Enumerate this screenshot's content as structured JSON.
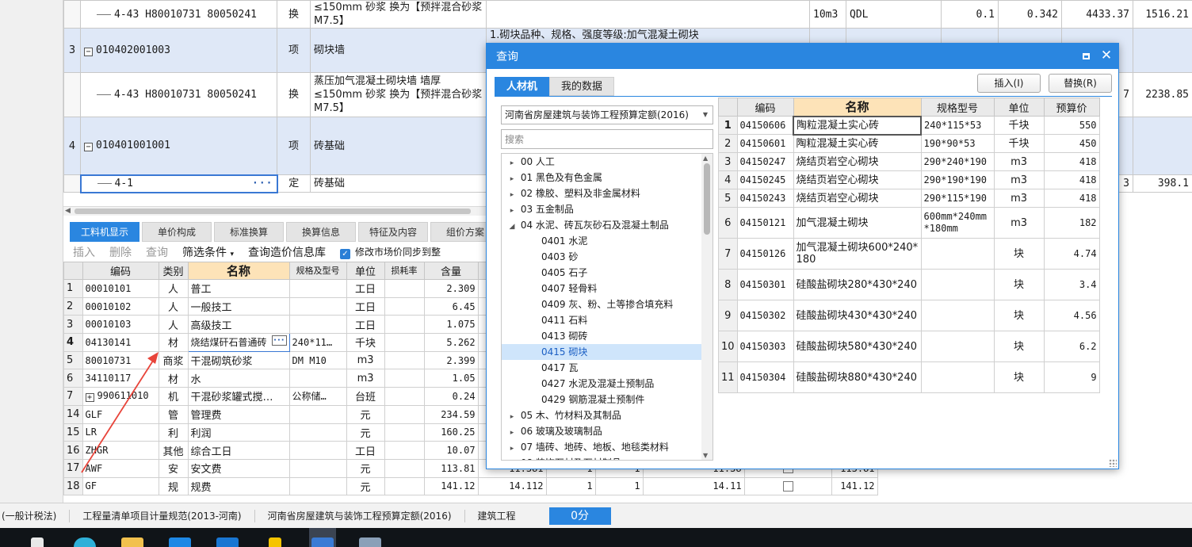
{
  "top_grid": {
    "rows": [
      {
        "kind": "sub",
        "no": "",
        "code": "4-43 H80010731 80050241",
        "type": "换",
        "name": "≤150mm 砂浆  换为【预拌混合砂浆 M7.5】",
        "feature": "",
        "unit": "10m3",
        "expr": "QDL",
        "qty1": "0.1",
        "qty2": "0.342",
        "price": "4433.37",
        "total": "1516.21"
      },
      {
        "kind": "item",
        "no": "3",
        "code": "010402001003",
        "type": "项",
        "name": "砌块墙",
        "feature": "1.砌块品种、规格、强度等级:加气混凝土砌块",
        "unit": "",
        "expr": "",
        "qty1": "",
        "qty2": "",
        "price": "",
        "total": ""
      },
      {
        "kind": "sub",
        "no": "",
        "code": "4-43 H80010731 80050241",
        "type": "换",
        "name": "蒸压加气混凝土砌块墙 墙厚≤150mm 砂浆  换为【预拌混合砂浆 M7.5】",
        "feature": "",
        "unit": "",
        "expr": "",
        "qty1": "",
        "qty2": "",
        "price": "7",
        "total": "2238.85"
      },
      {
        "kind": "item",
        "no": "4",
        "code": "010401001001",
        "type": "项",
        "name": "砖基础",
        "feature": "",
        "unit": "",
        "expr": "",
        "qty1": "",
        "qty2": "",
        "price": "",
        "total": ""
      },
      {
        "kind": "sub",
        "no": "",
        "code": "4-1",
        "type": "定",
        "name": "砖基础",
        "feature": "",
        "unit": "",
        "expr": "",
        "qty1": "",
        "qty2": "",
        "price": "3",
        "total": "398.1"
      }
    ]
  },
  "bottom_tabs": [
    "工料机显示",
    "单价构成",
    "标准换算",
    "换算信息",
    "特征及内容",
    "组价方案"
  ],
  "toolbar": {
    "insert": "插入",
    "delete": "删除",
    "query": "查询",
    "filter": "筛选条件",
    "query_info": "查询造价信息库",
    "sync_label": "修改市场价同步到整"
  },
  "bottom_grid": {
    "headers": [
      "",
      "编码",
      "类别",
      "名称",
      "规格及型号",
      "单位",
      "损耗率",
      "含量",
      "",
      "",
      "",
      "",
      "",
      ""
    ],
    "rows": [
      {
        "no": "1",
        "code": "00010101",
        "cat": "人",
        "name": "普工",
        "spec": "",
        "unit": "工日",
        "loss": "",
        "qty": "2.309",
        "c1": "",
        "c2": "",
        "c3": "",
        "c4": "",
        "c5": "",
        "c6": ""
      },
      {
        "no": "2",
        "code": "00010102",
        "cat": "人",
        "name": "一般技工",
        "spec": "",
        "unit": "工日",
        "loss": "",
        "qty": "6.45",
        "c1": "",
        "c2": "",
        "c3": "",
        "c4": "",
        "c5": "",
        "c6": ""
      },
      {
        "no": "3",
        "code": "00010103",
        "cat": "人",
        "name": "高级技工",
        "spec": "",
        "unit": "工日",
        "loss": "",
        "qty": "1.075",
        "c1": "",
        "c2": "",
        "c3": "",
        "c4": "",
        "c5": "",
        "c6": ""
      },
      {
        "no": "4",
        "code": "04130141",
        "cat": "材",
        "name": "烧结煤矸石普通砖",
        "spec": "240*11…",
        "unit": "千块",
        "loss": "",
        "qty": "5.262",
        "c1": "",
        "c2": "",
        "c3": "",
        "c4": "",
        "c5": "",
        "c6": ""
      },
      {
        "no": "5",
        "code": "80010731",
        "cat": "商浆",
        "name": "干混砌筑砂浆",
        "spec": "DM M10",
        "unit": "m3",
        "loss": "",
        "qty": "2.399",
        "c1": "",
        "c2": "",
        "c3": "",
        "c4": "",
        "c5": "",
        "c6": ""
      },
      {
        "no": "6",
        "code": "34110117",
        "cat": "材",
        "name": "水",
        "spec": "",
        "unit": "m3",
        "loss": "",
        "qty": "1.05",
        "c1": "",
        "c2": "",
        "c3": "",
        "c4": "",
        "c5": "",
        "c6": ""
      },
      {
        "no": "7",
        "code": "990611010",
        "cat": "机",
        "name": "干混砂浆罐式搅…",
        "spec": "公称储…",
        "unit": "台班",
        "loss": "",
        "qty": "0.24",
        "c1": "",
        "c2": "",
        "c3": "",
        "c4": "",
        "c5": "",
        "c6": ""
      },
      {
        "no": "14",
        "code": "GLF",
        "cat": "管",
        "name": "管理费",
        "spec": "",
        "unit": "元",
        "loss": "",
        "qty": "234.59",
        "c1": "",
        "c2": "",
        "c3": "",
        "c4": "",
        "c5": "",
        "c6": ""
      },
      {
        "no": "15",
        "code": "LR",
        "cat": "利",
        "name": "利润",
        "spec": "",
        "unit": "元",
        "loss": "",
        "qty": "160.25",
        "c1": "",
        "c2": "",
        "c3": "",
        "c4": "",
        "c5": "",
        "c6": ""
      },
      {
        "no": "16",
        "code": "ZHGR",
        "cat": "其他",
        "name": "综合工日",
        "spec": "",
        "unit": "工日",
        "loss": "",
        "qty": "10.07",
        "c1": "",
        "c2": "",
        "c3": "",
        "c4": "",
        "c5": "",
        "c6": ""
      },
      {
        "no": "17",
        "code": "AWF",
        "cat": "安",
        "name": "安文费",
        "spec": "",
        "unit": "元",
        "loss": "",
        "qty": "113.81",
        "c1": "11.381",
        "c2": "1",
        "c3": "1",
        "c4": "11.38",
        "c5": "",
        "c6": "113.81"
      },
      {
        "no": "18",
        "code": "GF",
        "cat": "规",
        "name": "规费",
        "spec": "",
        "unit": "元",
        "loss": "",
        "qty": "141.12",
        "c1": "14.112",
        "c2": "1",
        "c3": "1",
        "c4": "14.11",
        "c5": "",
        "c6": "141.12"
      }
    ]
  },
  "status_bar": {
    "tax": "(一般计税法)",
    "rule": "工程量清单项目计量规范(2013-河南)",
    "quota": "河南省房屋建筑与装饰工程预算定额(2016)",
    "project": "建筑工程",
    "score": "0分"
  },
  "dialog": {
    "title": "查询",
    "tabs": [
      "人材机",
      "我的数据"
    ],
    "insert_button": "插入(I)",
    "replace_button": "替换(R)",
    "library": "河南省房屋建筑与装饰工程预算定额(2016)",
    "search_placeholder": "搜索",
    "tree": [
      {
        "label": "00 人工",
        "level": 0,
        "expand": "right"
      },
      {
        "label": "01 黑色及有色金属",
        "level": 0,
        "expand": "right"
      },
      {
        "label": "02 橡胶、塑料及非金属材料",
        "level": 0,
        "expand": "right"
      },
      {
        "label": "03 五金制品",
        "level": 0,
        "expand": "right"
      },
      {
        "label": "04 水泥、砖瓦灰砂石及混凝土制品",
        "level": 0,
        "expand": "down"
      },
      {
        "label": "0401 水泥",
        "level": 1,
        "expand": ""
      },
      {
        "label": "0403 砂",
        "level": 1,
        "expand": ""
      },
      {
        "label": "0405 石子",
        "level": 1,
        "expand": ""
      },
      {
        "label": "0407 轻骨料",
        "level": 1,
        "expand": ""
      },
      {
        "label": "0409 灰、粉、土等掺合填充料",
        "level": 1,
        "expand": ""
      },
      {
        "label": "0411 石料",
        "level": 1,
        "expand": ""
      },
      {
        "label": "0413 砌砖",
        "level": 1,
        "expand": ""
      },
      {
        "label": "0415 砌块",
        "level": 1,
        "expand": "",
        "selected": true
      },
      {
        "label": "0417 瓦",
        "level": 1,
        "expand": ""
      },
      {
        "label": "0427 水泥及混凝土预制品",
        "level": 1,
        "expand": ""
      },
      {
        "label": "0429 钢筋混凝土预制件",
        "level": 1,
        "expand": ""
      },
      {
        "label": "05 木、竹材料及其制品",
        "level": 0,
        "expand": "right"
      },
      {
        "label": "06 玻璃及玻璃制品",
        "level": 0,
        "expand": "right"
      },
      {
        "label": "07 墙砖、地砖、地板、地毯类材料",
        "level": 0,
        "expand": "right"
      },
      {
        "label": "08 装饰石材及石材制品",
        "level": 0,
        "expand": "right"
      }
    ],
    "result_headers": [
      "",
      "编码",
      "名称",
      "规格型号",
      "单位",
      "预算价"
    ],
    "results": [
      {
        "no": "1",
        "code": "04150606",
        "name": "陶粒混凝土实心砖",
        "spec": "240*115*53",
        "unit": "千块",
        "price": "550"
      },
      {
        "no": "2",
        "code": "04150601",
        "name": "陶粒混凝土实心砖",
        "spec": "190*90*53",
        "unit": "千块",
        "price": "450"
      },
      {
        "no": "3",
        "code": "04150247",
        "name": "烧结页岩空心砌块",
        "spec": "290*240*190",
        "unit": "m3",
        "price": "418"
      },
      {
        "no": "4",
        "code": "04150245",
        "name": "烧结页岩空心砌块",
        "spec": "290*190*190",
        "unit": "m3",
        "price": "418"
      },
      {
        "no": "5",
        "code": "04150243",
        "name": "烧结页岩空心砌块",
        "spec": "290*115*190",
        "unit": "m3",
        "price": "418"
      },
      {
        "no": "6",
        "code": "04150121",
        "name": "加气混凝土砌块",
        "spec": "600mm*240mm*180mm",
        "unit": "m3",
        "price": "182"
      },
      {
        "no": "7",
        "code": "04150126",
        "name": "加气混凝土砌块600*240*180",
        "spec": "",
        "unit": "块",
        "price": "4.74"
      },
      {
        "no": "8",
        "code": "04150301",
        "name": "硅酸盐砌块280*430*240",
        "spec": "",
        "unit": "块",
        "price": "3.4"
      },
      {
        "no": "9",
        "code": "04150302",
        "name": "硅酸盐砌块430*430*240",
        "spec": "",
        "unit": "块",
        "price": "4.56"
      },
      {
        "no": "10",
        "code": "04150303",
        "name": "硅酸盐砌块580*430*240",
        "spec": "",
        "unit": "块",
        "price": "6.2"
      },
      {
        "no": "11",
        "code": "04150304",
        "name": "硅酸盐砌块880*430*240",
        "spec": "",
        "unit": "块",
        "price": "9"
      }
    ]
  },
  "colors": {
    "accent": "#2a86e0",
    "selection": "#dfe8f7",
    "header_highlight": "#fde3b8",
    "arrow": "#e8443a"
  },
  "icons": [
    "minus-box-icon",
    "dots-icon",
    "checkbox-checked-icon",
    "maximize-icon",
    "close-icon",
    "caret-down-icon",
    "expand-right-icon",
    "expand-down-icon",
    "plus-box-icon"
  ]
}
